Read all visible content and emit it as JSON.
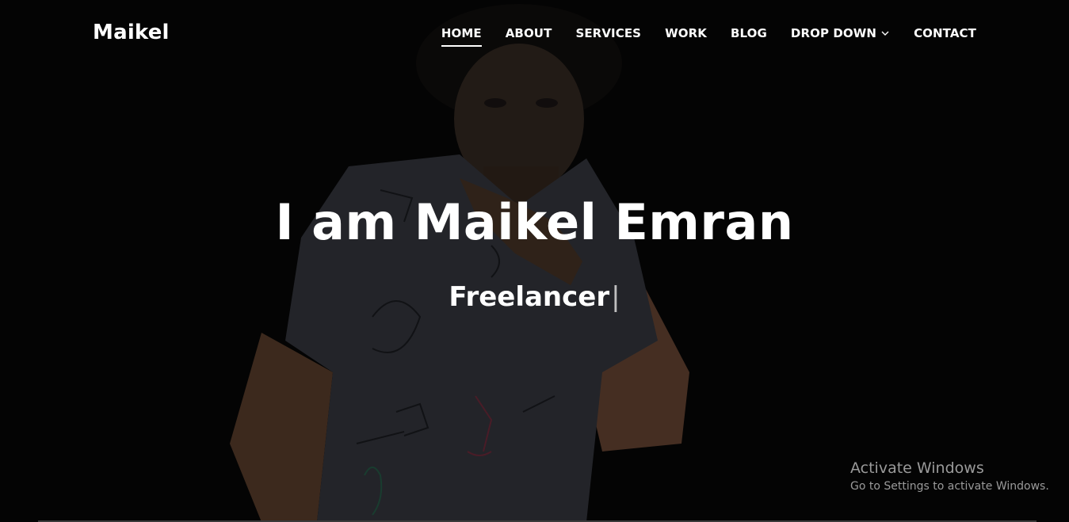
{
  "header": {
    "brand": "Maikel",
    "nav": [
      {
        "label": "HOME",
        "active": true
      },
      {
        "label": "ABOUT"
      },
      {
        "label": "SERVICES"
      },
      {
        "label": "WORK"
      },
      {
        "label": "BLOG"
      },
      {
        "label": "DROP DOWN",
        "icon": "chevron-down-icon"
      },
      {
        "label": "CONTACT"
      }
    ]
  },
  "hero": {
    "title": "I am Maikel Emran",
    "subtitle": "Freelancer",
    "caret": "|"
  },
  "watermark": {
    "title": "Activate Windows",
    "subtitle": "Go to Settings to activate Windows."
  },
  "colors": {
    "background": "#050505",
    "text": "#ffffff",
    "watermark": "#9a9a9a"
  }
}
